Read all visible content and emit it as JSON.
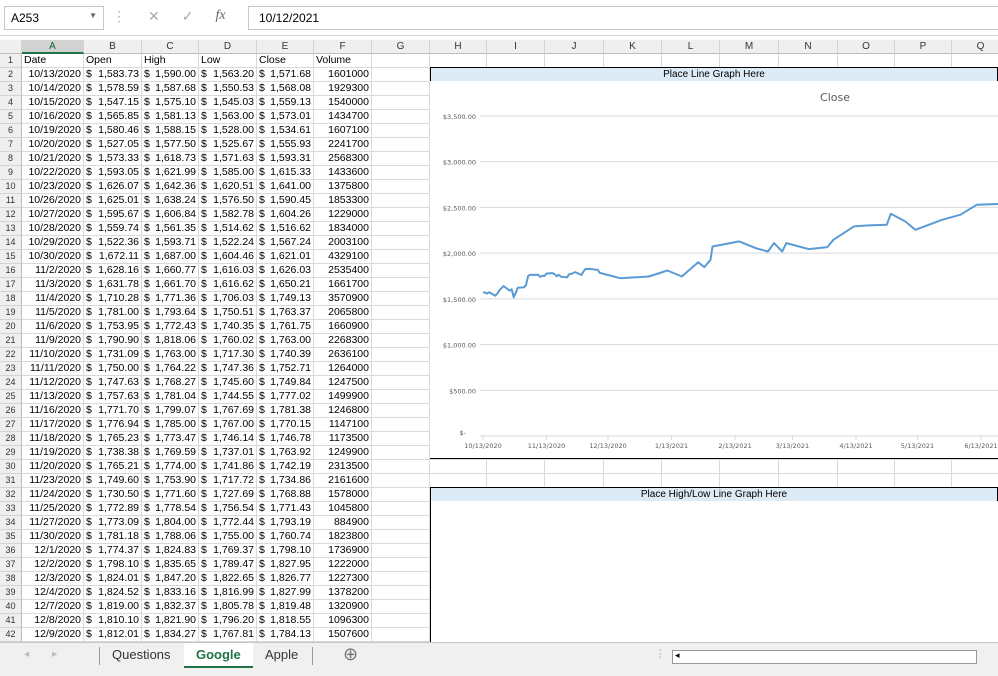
{
  "formula_bar": {
    "name_box": "A253",
    "formula": "10/12/2021",
    "cancel_icon": "✕",
    "enter_icon": "✓",
    "fx_icon": "fx"
  },
  "columns": [
    "A",
    "B",
    "C",
    "D",
    "E",
    "F",
    "G",
    "H",
    "I",
    "J",
    "K",
    "L",
    "M",
    "N",
    "O",
    "P",
    "Q"
  ],
  "headers": [
    "Date",
    "Open",
    "High",
    "Low",
    "Close",
    "Volume"
  ],
  "rows": [
    [
      "10/13/2020",
      "1,583.73",
      "1,590.00",
      "1,563.20",
      "1,571.68",
      "1601000"
    ],
    [
      "10/14/2020",
      "1,578.59",
      "1,587.68",
      "1,550.53",
      "1,568.08",
      "1929300"
    ],
    [
      "10/15/2020",
      "1,547.15",
      "1,575.10",
      "1,545.03",
      "1,559.13",
      "1540000"
    ],
    [
      "10/16/2020",
      "1,565.85",
      "1,581.13",
      "1,563.00",
      "1,573.01",
      "1434700"
    ],
    [
      "10/19/2020",
      "1,580.46",
      "1,588.15",
      "1,528.00",
      "1,534.61",
      "1607100"
    ],
    [
      "10/20/2020",
      "1,527.05",
      "1,577.50",
      "1,525.67",
      "1,555.93",
      "2241700"
    ],
    [
      "10/21/2020",
      "1,573.33",
      "1,618.73",
      "1,571.63",
      "1,593.31",
      "2568300"
    ],
    [
      "10/22/2020",
      "1,593.05",
      "1,621.99",
      "1,585.00",
      "1,615.33",
      "1433600"
    ],
    [
      "10/23/2020",
      "1,626.07",
      "1,642.36",
      "1,620.51",
      "1,641.00",
      "1375800"
    ],
    [
      "10/26/2020",
      "1,625.01",
      "1,638.24",
      "1,576.50",
      "1,590.45",
      "1853300"
    ],
    [
      "10/27/2020",
      "1,595.67",
      "1,606.84",
      "1,582.78",
      "1,604.26",
      "1229000"
    ],
    [
      "10/28/2020",
      "1,559.74",
      "1,561.35",
      "1,514.62",
      "1,516.62",
      "1834000"
    ],
    [
      "10/29/2020",
      "1,522.36",
      "1,593.71",
      "1,522.24",
      "1,567.24",
      "2003100"
    ],
    [
      "10/30/2020",
      "1,672.11",
      "1,687.00",
      "1,604.46",
      "1,621.01",
      "4329100"
    ],
    [
      "11/2/2020",
      "1,628.16",
      "1,660.77",
      "1,616.03",
      "1,626.03",
      "2535400"
    ],
    [
      "11/3/2020",
      "1,631.78",
      "1,661.70",
      "1,616.62",
      "1,650.21",
      "1661700"
    ],
    [
      "11/4/2020",
      "1,710.28",
      "1,771.36",
      "1,706.03",
      "1,749.13",
      "3570900"
    ],
    [
      "11/5/2020",
      "1,781.00",
      "1,793.64",
      "1,750.51",
      "1,763.37",
      "2065800"
    ],
    [
      "11/6/2020",
      "1,753.95",
      "1,772.43",
      "1,740.35",
      "1,761.75",
      "1660900"
    ],
    [
      "11/9/2020",
      "1,790.90",
      "1,818.06",
      "1,760.02",
      "1,763.00",
      "2268300"
    ],
    [
      "11/10/2020",
      "1,731.09",
      "1,763.00",
      "1,717.30",
      "1,740.39",
      "2636100"
    ],
    [
      "11/11/2020",
      "1,750.00",
      "1,764.22",
      "1,747.36",
      "1,752.71",
      "1264000"
    ],
    [
      "11/12/2020",
      "1,747.63",
      "1,768.27",
      "1,745.60",
      "1,749.84",
      "1247500"
    ],
    [
      "11/13/2020",
      "1,757.63",
      "1,781.04",
      "1,744.55",
      "1,777.02",
      "1499900"
    ],
    [
      "11/16/2020",
      "1,771.70",
      "1,799.07",
      "1,767.69",
      "1,781.38",
      "1246800"
    ],
    [
      "11/17/2020",
      "1,776.94",
      "1,785.00",
      "1,767.00",
      "1,770.15",
      "1147100"
    ],
    [
      "11/18/2020",
      "1,765.23",
      "1,773.47",
      "1,746.14",
      "1,746.78",
      "1173500"
    ],
    [
      "11/19/2020",
      "1,738.38",
      "1,769.59",
      "1,737.01",
      "1,763.92",
      "1249900"
    ],
    [
      "11/20/2020",
      "1,765.21",
      "1,774.00",
      "1,741.86",
      "1,742.19",
      "2313500"
    ],
    [
      "11/23/2020",
      "1,749.60",
      "1,753.90",
      "1,717.72",
      "1,734.86",
      "2161600"
    ],
    [
      "11/24/2020",
      "1,730.50",
      "1,771.60",
      "1,727.69",
      "1,768.88",
      "1578000"
    ],
    [
      "11/25/2020",
      "1,772.89",
      "1,778.54",
      "1,756.54",
      "1,771.43",
      "1045800"
    ],
    [
      "11/27/2020",
      "1,773.09",
      "1,804.00",
      "1,772.44",
      "1,793.19",
      "884900"
    ],
    [
      "11/30/2020",
      "1,781.18",
      "1,788.06",
      "1,755.00",
      "1,760.74",
      "1823800"
    ],
    [
      "12/1/2020",
      "1,774.37",
      "1,824.83",
      "1,769.37",
      "1,798.10",
      "1736900"
    ],
    [
      "12/2/2020",
      "1,798.10",
      "1,835.65",
      "1,789.47",
      "1,827.95",
      "1222000"
    ],
    [
      "12/3/2020",
      "1,824.01",
      "1,847.20",
      "1,822.65",
      "1,826.77",
      "1227300"
    ],
    [
      "12/4/2020",
      "1,824.52",
      "1,833.16",
      "1,816.99",
      "1,827.99",
      "1378200"
    ],
    [
      "12/7/2020",
      "1,819.00",
      "1,832.37",
      "1,805.78",
      "1,819.48",
      "1320900"
    ],
    [
      "12/8/2020",
      "1,810.10",
      "1,821.90",
      "1,796.20",
      "1,818.55",
      "1096300"
    ],
    [
      "12/9/2020",
      "1,812.01",
      "1,834.27",
      "1,767.81",
      "1,784.13",
      "1507600"
    ]
  ],
  "currency_symbol": "$",
  "banners": {
    "line": "Place Line Graph Here",
    "highlow": "Place High/Low Line Graph Here"
  },
  "chart_data": {
    "type": "line",
    "title": "Close",
    "xlabel": "",
    "ylabel": "",
    "ylim": [
      0,
      3500
    ],
    "grid": true,
    "legend": "none",
    "color": "#5b9bd5",
    "y_ticks": [
      "$-",
      "$500.00",
      "$1,000.00",
      "$1,500.00",
      "$2,000.00",
      "$2,500.00",
      "$3,000.00",
      "$3,500.00"
    ],
    "x_ticks": [
      "10/13/2020",
      "11/13/2020",
      "12/13/2020",
      "1/13/2021",
      "2/13/2021",
      "3/13/2021",
      "4/13/2021",
      "5/13/2021",
      "6/13/2021"
    ],
    "extra_points": [
      [
        "12/19/2020",
        1726
      ],
      [
        "1/2/2021",
        1745
      ],
      [
        "1/11/2021",
        1810
      ],
      [
        "1/18/2021",
        1745
      ],
      [
        "1/26/2021",
        1900
      ],
      [
        "1/29/2021",
        1847
      ],
      [
        "2/1/2021",
        1927
      ],
      [
        "2/2/2021",
        2073
      ],
      [
        "2/15/2021",
        2128
      ],
      [
        "2/23/2021",
        2055
      ],
      [
        "3/1/2021",
        2018
      ],
      [
        "3/4/2021",
        2110
      ],
      [
        "3/8/2021",
        2018
      ],
      [
        "3/10/2021",
        2110
      ],
      [
        "3/21/2021",
        2044
      ],
      [
        "3/30/2021",
        2066
      ],
      [
        "4/2/2021",
        2146
      ],
      [
        "4/12/2021",
        2292
      ],
      [
        "4/19/2021",
        2303
      ],
      [
        "4/28/2021",
        2310
      ],
      [
        "4/30/2021",
        2430
      ],
      [
        "5/7/2021",
        2347
      ],
      [
        "5/12/2021",
        2255
      ],
      [
        "5/25/2021",
        2365
      ],
      [
        "6/3/2021",
        2420
      ],
      [
        "6/11/2021",
        2530
      ],
      [
        "6/24/2021",
        2540
      ]
    ]
  },
  "sheet_tabs": [
    {
      "label": "Questions",
      "active": false
    },
    {
      "label": "Google",
      "active": true
    },
    {
      "label": "Apple",
      "active": false
    }
  ],
  "add_sheet_icon": "⊕"
}
